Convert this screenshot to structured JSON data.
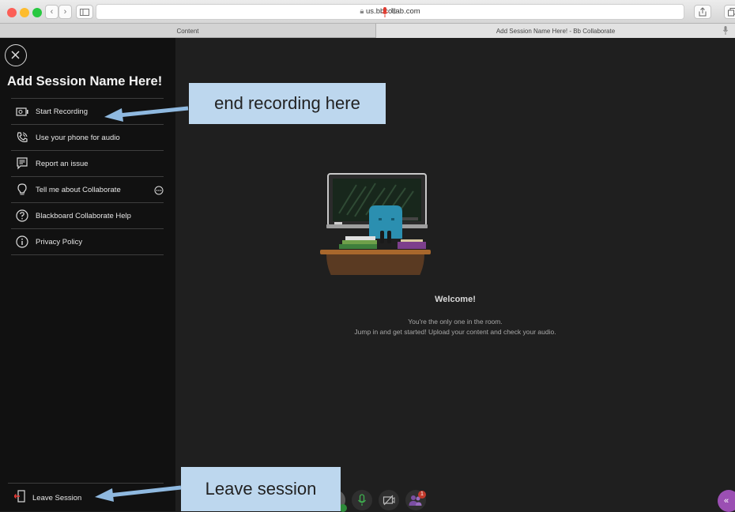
{
  "browser": {
    "url": "us.bbcollab.com",
    "tabs": [
      {
        "label": "Content"
      },
      {
        "label": "Add Session Name Here! - Bb Collaborate"
      }
    ]
  },
  "sidebar": {
    "session_name": "Add Session Name Here!",
    "items": [
      {
        "label": "Start Recording",
        "icon": "record-icon"
      },
      {
        "label": "Use your phone for audio",
        "icon": "phone-icon"
      },
      {
        "label": "Report an issue",
        "icon": "report-icon"
      },
      {
        "label": "Tell me about Collaborate",
        "icon": "lightbulb-icon"
      },
      {
        "label": "Blackboard Collaborate Help",
        "icon": "help-icon"
      },
      {
        "label": "Privacy Policy",
        "icon": "info-icon"
      }
    ],
    "leave_label": "Leave Session"
  },
  "main": {
    "welcome_title": "Welcome!",
    "welcome_line1": "You're the only one in the room.",
    "welcome_line2": "Jump in and get started! Upload your content and check your audio."
  },
  "annotations": {
    "end_recording": "end recording here",
    "leave_session": "Leave session"
  },
  "badges": {
    "participants_count": "1"
  },
  "colors": {
    "sidebar_bg": "#111111",
    "stage_bg": "#1f1f1f",
    "callout_bg": "#bdd7ee",
    "arrow": "#8fb9e0",
    "mic_green": "#2e8b3a",
    "participants_purple": "#7b4fa3",
    "collapse_purple": "#9b4fb3"
  }
}
